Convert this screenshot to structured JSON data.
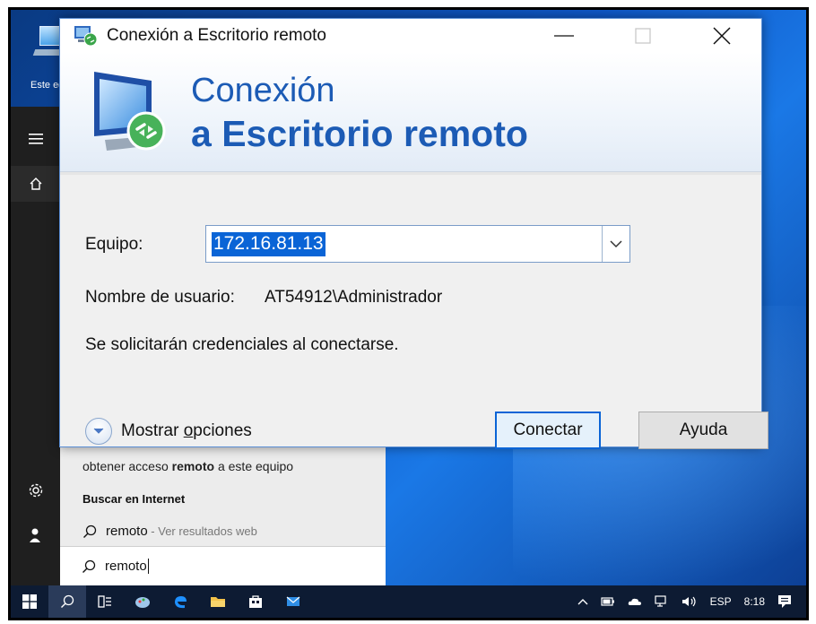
{
  "desktop": {
    "icon_label": "Este eq"
  },
  "start_panel": {
    "result_fragment_pre": "obtener acceso ",
    "result_fragment_bold": "remoto",
    "result_fragment_post": " a este equipo",
    "section_title": "Buscar en Internet",
    "web_result_query": "remoto",
    "web_result_suffix": " - Ver resultados web",
    "search_value": "remoto"
  },
  "dialog": {
    "title": "Conexión a Escritorio remoto",
    "banner_line1": "Conexión",
    "banner_line2": "a Escritorio remoto",
    "equipo_label": "Equipo:",
    "equipo_value": "172.16.81.13",
    "user_label": "Nombre de usuario:",
    "user_value": "AT54912\\Administrador",
    "credentials_note": "Se solicitarán credenciales al conectarse.",
    "show_options_pre": "Mostrar ",
    "show_options_hotkey": "o",
    "show_options_post": "pciones",
    "connect_label": "Conectar",
    "help_label": "Ayuda"
  },
  "taskbar": {
    "language": "ESP",
    "clock": "8:18"
  },
  "colors": {
    "accent": "#0a64d6",
    "banner_text": "#1c5bb5",
    "taskbar": "#0d1b33"
  }
}
